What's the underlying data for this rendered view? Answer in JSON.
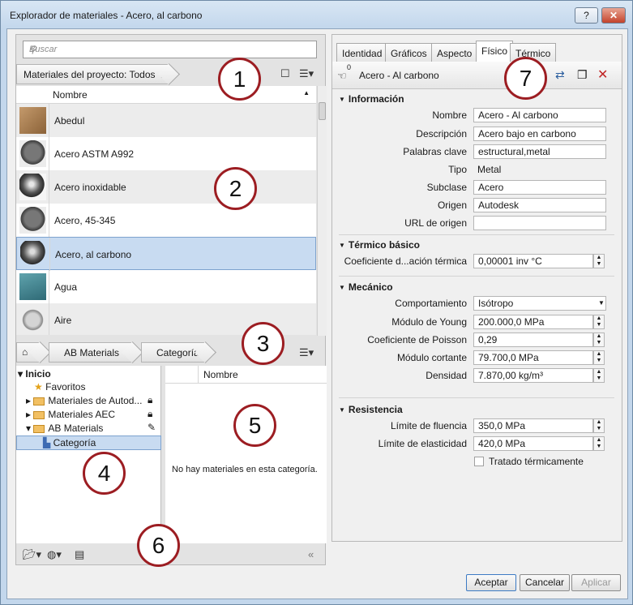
{
  "window": {
    "title": "Explorador de materiales - Acero, al carbono",
    "help": "?",
    "close": "✕"
  },
  "search": {
    "placeholder": "Buscar"
  },
  "library": {
    "filter": "Materiales del proyecto: Todos",
    "column": "Nombre",
    "materials": [
      "Abedul",
      "Acero ASTM A992",
      "Acero inoxidable",
      "Acero, 45-345",
      "Acero, al carbono",
      "Agua",
      "Aire"
    ],
    "selected": "Acero, al carbono"
  },
  "lower": {
    "home": "⌂",
    "crumb1": "AB Materials",
    "crumb2": "Categoría",
    "column": "Nombre",
    "empty": "No hay materiales en esta categoría.",
    "tree": {
      "root": "Inicio",
      "favorites": "Favoritos",
      "n1": "Materiales de Autod...",
      "n2": "Materiales AEC",
      "n3": "AB Materials",
      "n4": "Categoría"
    }
  },
  "callouts": [
    "1",
    "2",
    "3",
    "4",
    "5",
    "6",
    "7"
  ],
  "editor": {
    "tabs": [
      "Identidad",
      "Gráficos",
      "Aspecto",
      "Físico",
      "Térmico"
    ],
    "active_tab": "Físico",
    "asset_name": "Acero - Al carbono",
    "asset_count": "0",
    "info": {
      "title": "Información",
      "fields": [
        {
          "label": "Nombre",
          "value": "Acero - Al carbono"
        },
        {
          "label": "Descripción",
          "value": "Acero bajo en carbono"
        },
        {
          "label": "Palabras clave",
          "value": "estructural,metal"
        },
        {
          "label": "Tipo",
          "value": "Metal"
        },
        {
          "label": "Subclase",
          "value": "Acero"
        },
        {
          "label": "Origen",
          "value": "Autodesk"
        },
        {
          "label": "URL de origen",
          "value": ""
        }
      ]
    },
    "thermal": {
      "title": "Térmico básico",
      "label": "Coeficiente d...ación térmica",
      "value": "0,00001 inv °C"
    },
    "mech": {
      "title": "Mecánico",
      "fields": [
        {
          "label": "Comportamiento",
          "value": "Isótropo"
        },
        {
          "label": "Módulo de Young",
          "value": "200.000,0 MPa"
        },
        {
          "label": "Coeficiente de Poisson",
          "value": "0,29"
        },
        {
          "label": "Módulo cortante",
          "value": "79.700,0 MPa"
        },
        {
          "label": "Densidad",
          "value": "7.870,00 kg/m³"
        }
      ]
    },
    "strength": {
      "title": "Resistencia",
      "fields": [
        {
          "label": "Límite de fluencia",
          "value": "350,0 MPa"
        },
        {
          "label": "Límite de elasticidad",
          "value": "420,0 MPa"
        }
      ],
      "check": "Tratado térmicamente"
    }
  },
  "buttons": {
    "ok": "Aceptar",
    "cancel": "Cancelar",
    "apply": "Aplicar"
  },
  "colors": {
    "accent": "#c8dbf1",
    "callout_ring": "#9c1d22"
  }
}
